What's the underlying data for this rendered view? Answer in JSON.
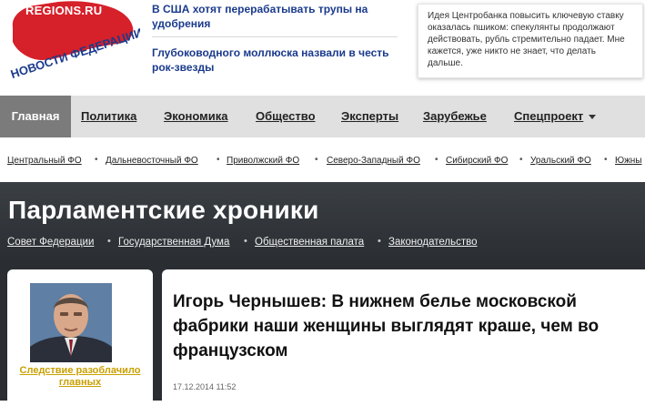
{
  "logo": {
    "site": "REGIONS.RU",
    "tagline": "НОВОСТИ ФЕДЕРАЦИИ"
  },
  "news": [
    "В США хотят перерабатывать трупы на удобрения",
    "Глубоководного моллюска назвали в честь рок-звезды"
  ],
  "quote": "Идея Центробанка повысить ключевую ставку оказалась пшиком: спекулянты продолжают действовать, рубль стремительно падает. Мне кажется, уже никто не знает, что делать дальше.",
  "nav": {
    "items": [
      "Главная",
      "Политика",
      "Экономика",
      "Общество",
      "Эксперты",
      "Зарубежье",
      "Спецпроект"
    ]
  },
  "districts": [
    "Центральный ФО",
    "Дальневосточный ФО",
    "Приволжский ФО",
    "Северо-Западный ФО",
    "Сибирский ФО",
    "Уральский ФО",
    "Южны"
  ],
  "section": {
    "title": "Парламентские хроники",
    "subnav": [
      "Совет Федерации",
      "Государственная Дума",
      "Общественная палата",
      "Законодательство"
    ]
  },
  "side_story": {
    "caption": "Следствие разоблачило главных"
  },
  "article": {
    "headline": "Игорь Чернышев: В нижнем белье московской фабрики наши женщины выглядят краше, чем во французском",
    "date": "17.12.2014 11:52"
  },
  "colors": {
    "logo_red": "#d6202a",
    "link_blue": "#1a3a8c",
    "nav_active": "#7b7b7b",
    "caption_gold": "#c9a000"
  }
}
